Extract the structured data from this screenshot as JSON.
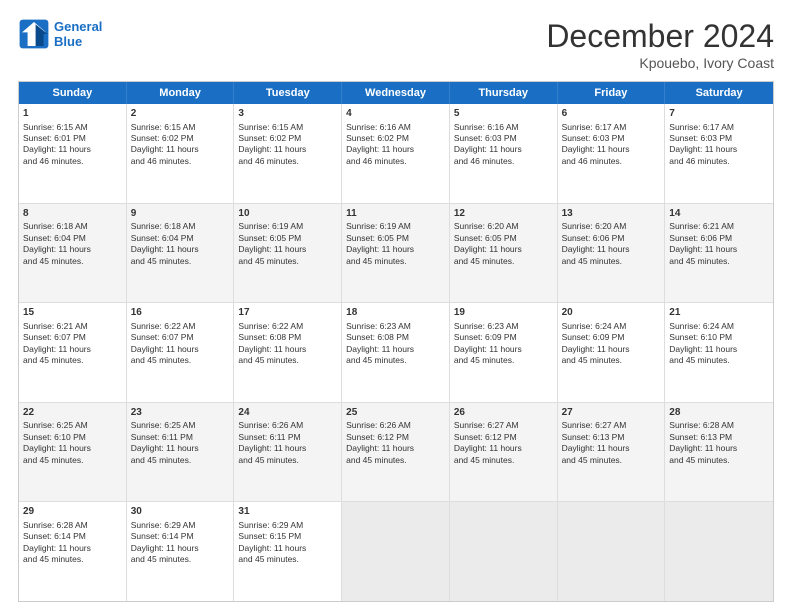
{
  "header": {
    "logo_line1": "General",
    "logo_line2": "Blue",
    "title": "December 2024",
    "subtitle": "Kpouebo, Ivory Coast"
  },
  "weekdays": [
    "Sunday",
    "Monday",
    "Tuesday",
    "Wednesday",
    "Thursday",
    "Friday",
    "Saturday"
  ],
  "rows": [
    [
      {
        "day": "1",
        "lines": [
          "Sunrise: 6:15 AM",
          "Sunset: 6:01 PM",
          "Daylight: 11 hours",
          "and 46 minutes."
        ]
      },
      {
        "day": "2",
        "lines": [
          "Sunrise: 6:15 AM",
          "Sunset: 6:02 PM",
          "Daylight: 11 hours",
          "and 46 minutes."
        ]
      },
      {
        "day": "3",
        "lines": [
          "Sunrise: 6:15 AM",
          "Sunset: 6:02 PM",
          "Daylight: 11 hours",
          "and 46 minutes."
        ]
      },
      {
        "day": "4",
        "lines": [
          "Sunrise: 6:16 AM",
          "Sunset: 6:02 PM",
          "Daylight: 11 hours",
          "and 46 minutes."
        ]
      },
      {
        "day": "5",
        "lines": [
          "Sunrise: 6:16 AM",
          "Sunset: 6:03 PM",
          "Daylight: 11 hours",
          "and 46 minutes."
        ]
      },
      {
        "day": "6",
        "lines": [
          "Sunrise: 6:17 AM",
          "Sunset: 6:03 PM",
          "Daylight: 11 hours",
          "and 46 minutes."
        ]
      },
      {
        "day": "7",
        "lines": [
          "Sunrise: 6:17 AM",
          "Sunset: 6:03 PM",
          "Daylight: 11 hours",
          "and 46 minutes."
        ]
      }
    ],
    [
      {
        "day": "8",
        "lines": [
          "Sunrise: 6:18 AM",
          "Sunset: 6:04 PM",
          "Daylight: 11 hours",
          "and 45 minutes."
        ]
      },
      {
        "day": "9",
        "lines": [
          "Sunrise: 6:18 AM",
          "Sunset: 6:04 PM",
          "Daylight: 11 hours",
          "and 45 minutes."
        ]
      },
      {
        "day": "10",
        "lines": [
          "Sunrise: 6:19 AM",
          "Sunset: 6:05 PM",
          "Daylight: 11 hours",
          "and 45 minutes."
        ]
      },
      {
        "day": "11",
        "lines": [
          "Sunrise: 6:19 AM",
          "Sunset: 6:05 PM",
          "Daylight: 11 hours",
          "and 45 minutes."
        ]
      },
      {
        "day": "12",
        "lines": [
          "Sunrise: 6:20 AM",
          "Sunset: 6:05 PM",
          "Daylight: 11 hours",
          "and 45 minutes."
        ]
      },
      {
        "day": "13",
        "lines": [
          "Sunrise: 6:20 AM",
          "Sunset: 6:06 PM",
          "Daylight: 11 hours",
          "and 45 minutes."
        ]
      },
      {
        "day": "14",
        "lines": [
          "Sunrise: 6:21 AM",
          "Sunset: 6:06 PM",
          "Daylight: 11 hours",
          "and 45 minutes."
        ]
      }
    ],
    [
      {
        "day": "15",
        "lines": [
          "Sunrise: 6:21 AM",
          "Sunset: 6:07 PM",
          "Daylight: 11 hours",
          "and 45 minutes."
        ]
      },
      {
        "day": "16",
        "lines": [
          "Sunrise: 6:22 AM",
          "Sunset: 6:07 PM",
          "Daylight: 11 hours",
          "and 45 minutes."
        ]
      },
      {
        "day": "17",
        "lines": [
          "Sunrise: 6:22 AM",
          "Sunset: 6:08 PM",
          "Daylight: 11 hours",
          "and 45 minutes."
        ]
      },
      {
        "day": "18",
        "lines": [
          "Sunrise: 6:23 AM",
          "Sunset: 6:08 PM",
          "Daylight: 11 hours",
          "and 45 minutes."
        ]
      },
      {
        "day": "19",
        "lines": [
          "Sunrise: 6:23 AM",
          "Sunset: 6:09 PM",
          "Daylight: 11 hours",
          "and 45 minutes."
        ]
      },
      {
        "day": "20",
        "lines": [
          "Sunrise: 6:24 AM",
          "Sunset: 6:09 PM",
          "Daylight: 11 hours",
          "and 45 minutes."
        ]
      },
      {
        "day": "21",
        "lines": [
          "Sunrise: 6:24 AM",
          "Sunset: 6:10 PM",
          "Daylight: 11 hours",
          "and 45 minutes."
        ]
      }
    ],
    [
      {
        "day": "22",
        "lines": [
          "Sunrise: 6:25 AM",
          "Sunset: 6:10 PM",
          "Daylight: 11 hours",
          "and 45 minutes."
        ]
      },
      {
        "day": "23",
        "lines": [
          "Sunrise: 6:25 AM",
          "Sunset: 6:11 PM",
          "Daylight: 11 hours",
          "and 45 minutes."
        ]
      },
      {
        "day": "24",
        "lines": [
          "Sunrise: 6:26 AM",
          "Sunset: 6:11 PM",
          "Daylight: 11 hours",
          "and 45 minutes."
        ]
      },
      {
        "day": "25",
        "lines": [
          "Sunrise: 6:26 AM",
          "Sunset: 6:12 PM",
          "Daylight: 11 hours",
          "and 45 minutes."
        ]
      },
      {
        "day": "26",
        "lines": [
          "Sunrise: 6:27 AM",
          "Sunset: 6:12 PM",
          "Daylight: 11 hours",
          "and 45 minutes."
        ]
      },
      {
        "day": "27",
        "lines": [
          "Sunrise: 6:27 AM",
          "Sunset: 6:13 PM",
          "Daylight: 11 hours",
          "and 45 minutes."
        ]
      },
      {
        "day": "28",
        "lines": [
          "Sunrise: 6:28 AM",
          "Sunset: 6:13 PM",
          "Daylight: 11 hours",
          "and 45 minutes."
        ]
      }
    ],
    [
      {
        "day": "29",
        "lines": [
          "Sunrise: 6:28 AM",
          "Sunset: 6:14 PM",
          "Daylight: 11 hours",
          "and 45 minutes."
        ]
      },
      {
        "day": "30",
        "lines": [
          "Sunrise: 6:29 AM",
          "Sunset: 6:14 PM",
          "Daylight: 11 hours",
          "and 45 minutes."
        ]
      },
      {
        "day": "31",
        "lines": [
          "Sunrise: 6:29 AM",
          "Sunset: 6:15 PM",
          "Daylight: 11 hours",
          "and 45 minutes."
        ]
      },
      {
        "day": "",
        "lines": []
      },
      {
        "day": "",
        "lines": []
      },
      {
        "day": "",
        "lines": []
      },
      {
        "day": "",
        "lines": []
      }
    ]
  ]
}
